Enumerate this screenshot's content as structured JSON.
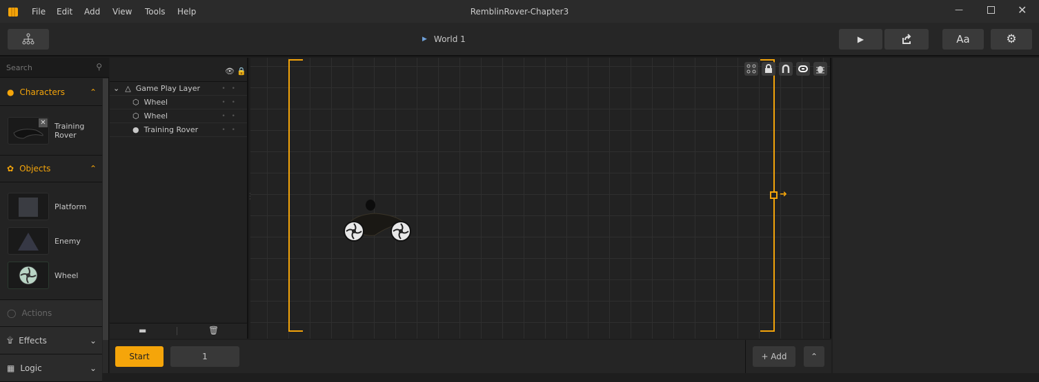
{
  "app": {
    "title": "RemblinRover-Chapter3",
    "accent": "#f5a50a"
  },
  "menu": [
    "File",
    "Edit",
    "Add",
    "View",
    "Tools",
    "Help"
  ],
  "toolbar": {
    "world": "World 1",
    "font_button": "Aa"
  },
  "search": {
    "placeholder": "Search"
  },
  "sections": {
    "characters": {
      "label": "Characters",
      "items": [
        {
          "label": "Training\nRover"
        }
      ]
    },
    "objects": {
      "label": "Objects",
      "items": [
        {
          "label": "Platform"
        },
        {
          "label": "Enemy"
        },
        {
          "label": "Wheel"
        }
      ]
    },
    "actions": {
      "label": "Actions"
    },
    "effects": {
      "label": "Effects"
    },
    "logic": {
      "label": "Logic"
    }
  },
  "layers": [
    {
      "label": "Game Play Layer",
      "icon": "layer-icon"
    },
    {
      "label": "Wheel",
      "icon": "hexagon-icon"
    },
    {
      "label": "Wheel",
      "icon": "hexagon-icon"
    },
    {
      "label": "Training Rover",
      "icon": "person-icon"
    }
  ],
  "bottom": {
    "start": "Start",
    "frame": "1",
    "add": "+ Add"
  }
}
